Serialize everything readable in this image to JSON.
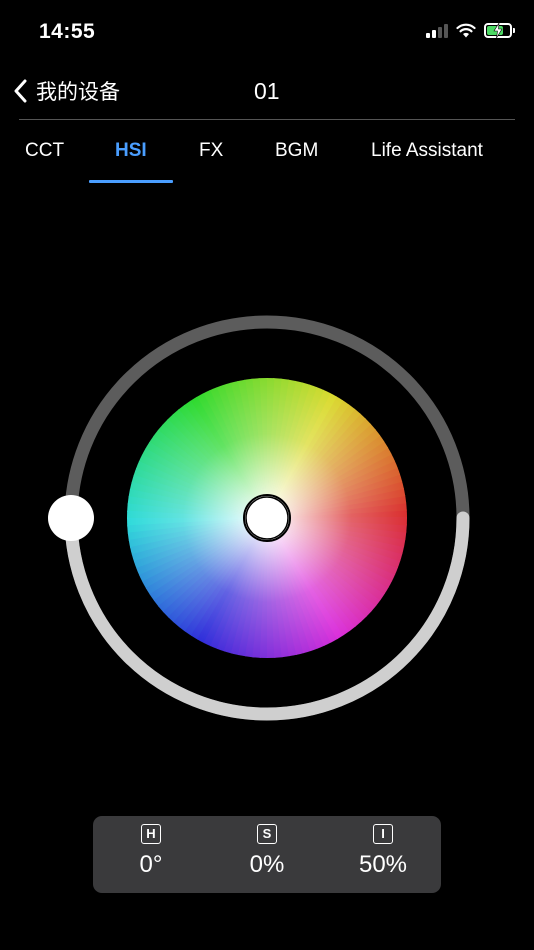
{
  "status_bar": {
    "time": "14:55",
    "battery_level": 0.8,
    "battery_color": "#4cd964"
  },
  "nav": {
    "back_label": "我的设备",
    "title": "01"
  },
  "tabs": [
    {
      "label": "CCT",
      "active": false
    },
    {
      "label": "HSI",
      "active": true
    },
    {
      "label": "FX",
      "active": false
    },
    {
      "label": "BGM",
      "active": false
    },
    {
      "label": "Life Assistant",
      "active": false
    }
  ],
  "accent_color": "#4a9eff",
  "color_wheel": {
    "hue": 0,
    "saturation": 0
  },
  "intensity_slider": {
    "value": 0.5
  },
  "hsi": {
    "h": {
      "badge": "H",
      "value": "0°"
    },
    "s": {
      "badge": "S",
      "value": "0%"
    },
    "i": {
      "badge": "I",
      "value": "50%"
    }
  }
}
